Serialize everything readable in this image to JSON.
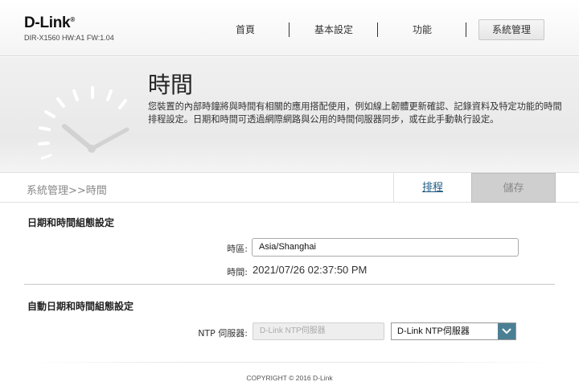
{
  "header": {
    "logo": "D-Link",
    "model": "DIR-X1560 HW:A1 FW:1.04",
    "nav": [
      {
        "label": "首頁"
      },
      {
        "label": "基本設定"
      },
      {
        "label": "功能"
      },
      {
        "label": "系統管理",
        "active": true
      }
    ]
  },
  "banner": {
    "title": "時間",
    "description": "您裝置的內部時鐘將與時間有相關的應用搭配使用，例如線上韌體更新確認、記錄資料及特定功能的時間排程設定。日期和時間可透過網際網路與公用的時間伺服器同步，或在此手動執行設定。"
  },
  "breadcrumb": "系統管理>>時間",
  "actions": {
    "schedule": "排程",
    "save": "儲存"
  },
  "datetime": {
    "section_title": "日期和時間組態設定",
    "timezone_label": "時區:",
    "timezone_value": "Asia/Shanghai",
    "time_label": "時間:",
    "time_value": "2021/07/26 02:37:50 PM"
  },
  "ntp": {
    "section_title": "自動日期和時間組態設定",
    "server_label": "NTP 伺服器:",
    "server_input_placeholder": "D-Link NTP伺服器",
    "server_select_value": "D-Link NTP伺服器"
  },
  "footer": {
    "copyright": "COPYRIGHT © 2016 D-Link"
  },
  "colors": {
    "accent": "#4b7f93",
    "link": "#1e5a82",
    "save_bg": "#cfcfcf"
  }
}
